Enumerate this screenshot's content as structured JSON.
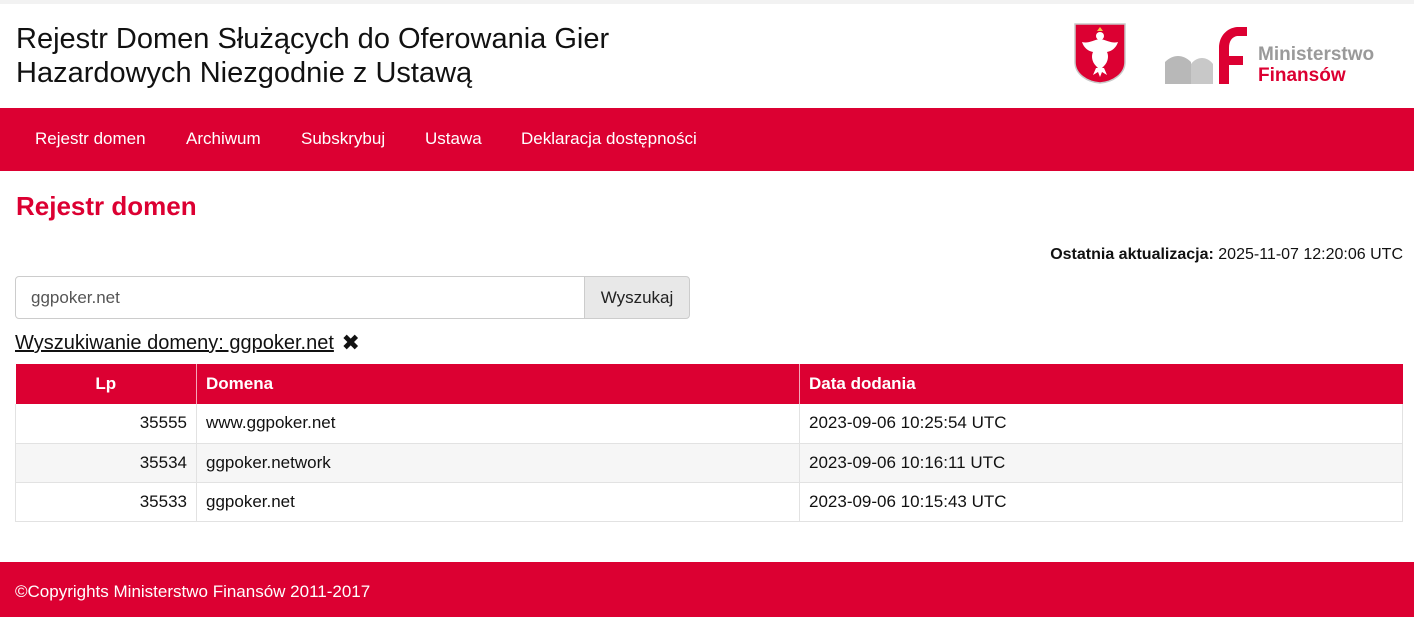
{
  "header": {
    "title_line1": "Rejestr Domen Służących do Oferowania Gier",
    "title_line2": "Hazardowych Niezgodnie z Ustawą",
    "logo_line1": "Ministerstwo",
    "logo_line2": "Finansów",
    "brand_color": "#dc0032",
    "emblem_icon": "polish-eagle-emblem"
  },
  "nav": {
    "items": [
      "Rejestr domen",
      "Archiwum",
      "Subskrybuj",
      "Ustawa",
      "Deklaracja dostępności"
    ]
  },
  "main": {
    "page_title": "Rejestr domen",
    "last_update_label": "Ostatnia aktualizacja:",
    "last_update_value": "2025-11-07 12:20:06 UTC",
    "search": {
      "value": "ggpoker.net",
      "button_label": "Wyszukaj",
      "info_text": "Wyszukiwanie domeny: ggpoker.net",
      "clear_icon": "✖"
    },
    "table": {
      "headers": [
        "Lp",
        "Domena",
        "Data dodania"
      ],
      "rows": [
        [
          "35555",
          "www.ggpoker.net",
          "2023-09-06 10:25:54 UTC"
        ],
        [
          "35534",
          "ggpoker.network",
          "2023-09-06 10:16:11 UTC"
        ],
        [
          "35533",
          "ggpoker.net",
          "2023-09-06 10:15:43 UTC"
        ]
      ]
    }
  },
  "footer": {
    "text": "©Copyrights Ministerstwo Finansów 2011-2017"
  }
}
